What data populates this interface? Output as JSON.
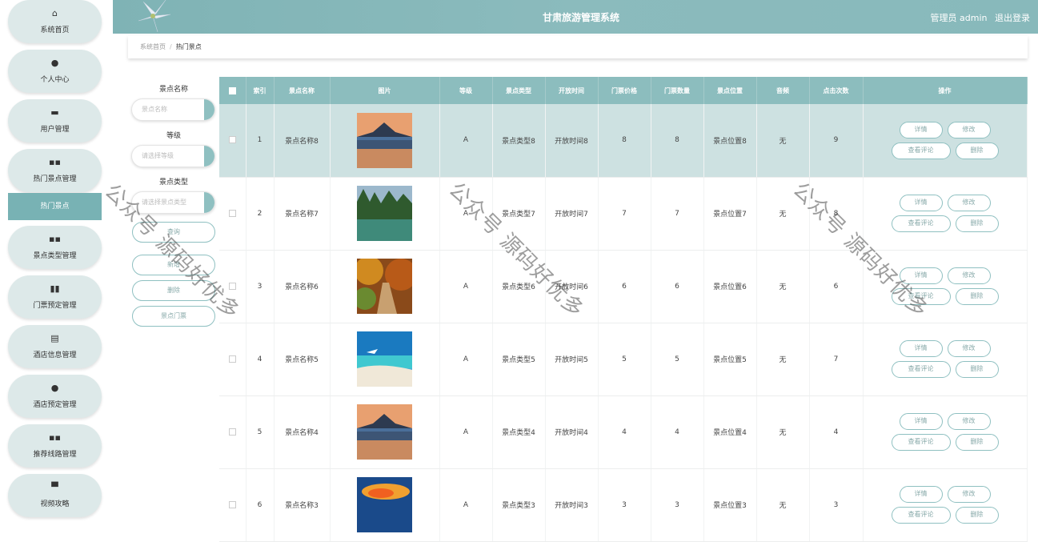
{
  "app": {
    "title": "甘肃旅游管理系统",
    "user_label": "管理员 admin",
    "logout": "退出登录"
  },
  "sidebar": {
    "items": [
      {
        "label": "系统首页",
        "icon": "home-icon",
        "glyph": "⌂"
      },
      {
        "label": "个人中心",
        "icon": "user-icon",
        "glyph": "●"
      },
      {
        "label": "用户管理",
        "icon": "briefcase-icon",
        "glyph": "▬"
      },
      {
        "label": "热门景点管理",
        "icon": "grid-icon",
        "glyph": "▪▪"
      },
      {
        "label": "景点类型管理",
        "icon": "grid-icon",
        "glyph": "▪▪"
      },
      {
        "label": "门票预定管理",
        "icon": "bar-chart-icon",
        "glyph": "▮▮"
      },
      {
        "label": "酒店信息管理",
        "icon": "clipboard-icon",
        "glyph": "▤"
      },
      {
        "label": "酒店预定管理",
        "icon": "pin-icon",
        "glyph": "●"
      },
      {
        "label": "推荐线路管理",
        "icon": "grid-icon",
        "glyph": "▪▪"
      },
      {
        "label": "视频攻略",
        "icon": "monitor-icon",
        "glyph": "▀"
      }
    ],
    "sub_active": "热门景点"
  },
  "breadcrumb": {
    "home": "系统首页",
    "sep": "/",
    "current": "热门景点"
  },
  "search": {
    "name_label": "景点名称",
    "name_placeholder": "景点名称",
    "level_label": "等级",
    "level_placeholder": "请选择等级",
    "type_label": "景点类型",
    "type_placeholder": "请选择景点类型",
    "query_btn": "查询",
    "add_btn": "新增",
    "delete_btn": "删除",
    "ticket_btn": "景点门票"
  },
  "table": {
    "headers": [
      "",
      "索引",
      "景点名称",
      "图片",
      "等级",
      "景点类型",
      "开放时间",
      "门票价格",
      "门票数量",
      "景点位置",
      "音频",
      "点击次数",
      "操作"
    ],
    "actions": {
      "detail": "详情",
      "edit": "修改",
      "comments": "查看评论",
      "delete": "删除"
    },
    "rows": [
      {
        "index": "1",
        "name": "景点名称8",
        "level": "A",
        "type": "景点类型8",
        "open": "开放时间8",
        "price": "8",
        "count": "8",
        "location": "景点位置8",
        "audio": "无",
        "clicks": "9",
        "img": "sunset-lake"
      },
      {
        "index": "2",
        "name": "景点名称7",
        "level": "A",
        "type": "景点类型7",
        "open": "开放时间7",
        "price": "7",
        "count": "7",
        "location": "景点位置7",
        "audio": "无",
        "clicks": "8",
        "img": "forest-river"
      },
      {
        "index": "3",
        "name": "景点名称6",
        "level": "A",
        "type": "景点类型6",
        "open": "开放时间6",
        "price": "6",
        "count": "6",
        "location": "景点位置6",
        "audio": "无",
        "clicks": "6",
        "img": "autumn-path"
      },
      {
        "index": "4",
        "name": "景点名称5",
        "level": "A",
        "type": "景点类型5",
        "open": "开放时间5",
        "price": "5",
        "count": "5",
        "location": "景点位置5",
        "audio": "无",
        "clicks": "7",
        "img": "beach"
      },
      {
        "index": "5",
        "name": "景点名称4",
        "level": "A",
        "type": "景点类型4",
        "open": "开放时间4",
        "price": "4",
        "count": "4",
        "location": "景点位置4",
        "audio": "无",
        "clicks": "4",
        "img": "sunset-lake"
      },
      {
        "index": "6",
        "name": "景点名称3",
        "level": "A",
        "type": "景点类型3",
        "open": "开放时间3",
        "price": "3",
        "count": "3",
        "location": "景点位置3",
        "audio": "无",
        "clicks": "3",
        "img": "cloud-sunset"
      }
    ]
  },
  "watermark": "公众号 源码好优多",
  "colors": {
    "accent": "#8cbdbe",
    "sidebar_active": "#78b2b4",
    "nav_pill": "#dde9e9",
    "row_highlight": "#cde1e1"
  }
}
